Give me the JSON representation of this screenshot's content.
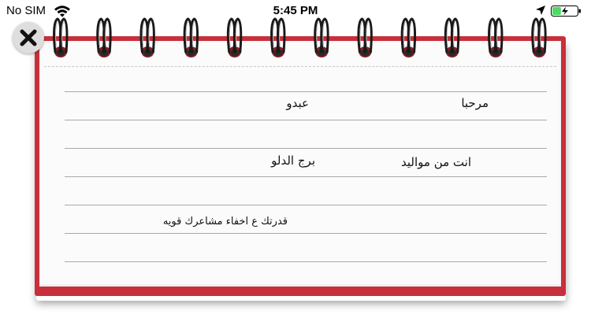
{
  "status_bar": {
    "carrier": "No SIM",
    "time": "5:45 PM",
    "wifi_icon": "wifi-icon",
    "location_icon": "location-arrow-icon",
    "battery_icon": "battery-charging-icon",
    "battery_level": 0.35,
    "battery_color": "#4cd964"
  },
  "notebook": {
    "border_color": "#c7303a",
    "rings_count": 12,
    "close_icon": "close-x-icon",
    "lines": {
      "greeting": "مرحبا",
      "name": "عبدو",
      "born_label": "انت من مواليد",
      "zodiac": "برج الدلو",
      "trait": "قدرتك ع اخفاء مشاعرك قويه"
    }
  }
}
